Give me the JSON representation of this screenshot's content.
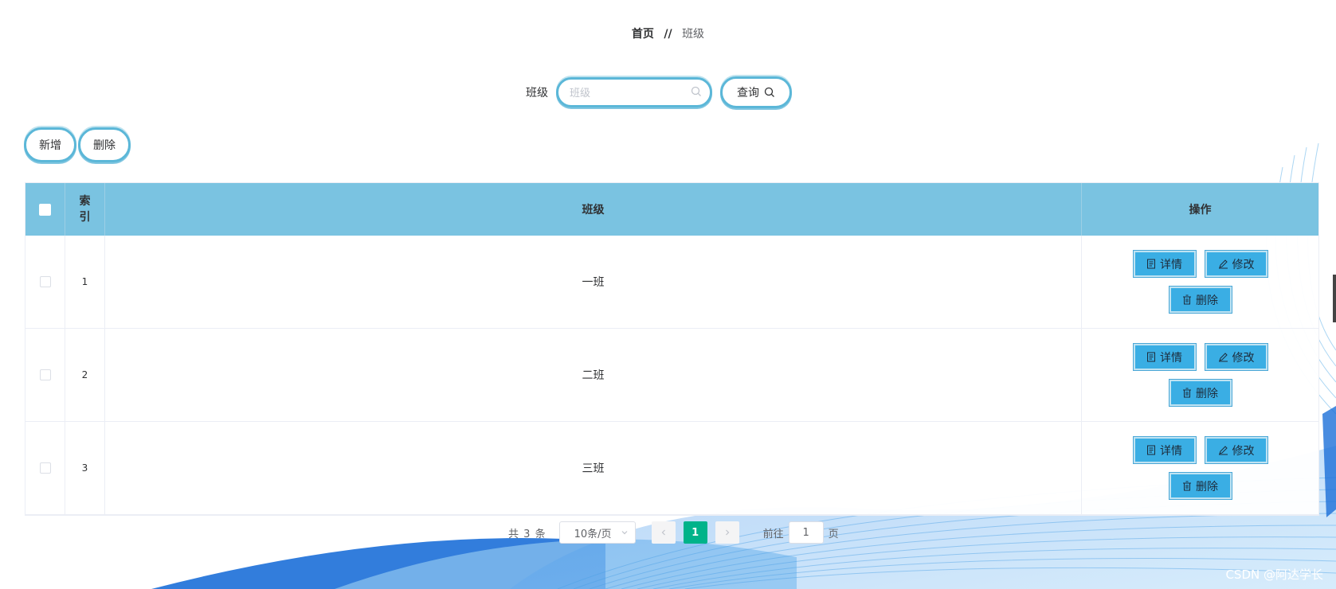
{
  "breadcrumb": {
    "home": "首页",
    "separator": "//",
    "current": "班级"
  },
  "search": {
    "label": "班级",
    "placeholder": "班级",
    "value": "",
    "query_label": "查询"
  },
  "actions": {
    "add_label": "新增",
    "delete_label": "删除"
  },
  "table": {
    "headers": {
      "index": "索引",
      "class": "班级",
      "ops": "操作"
    },
    "rows": [
      {
        "index": "1",
        "class": "一班"
      },
      {
        "index": "2",
        "class": "二班"
      },
      {
        "index": "3",
        "class": "三班"
      }
    ],
    "row_buttons": {
      "detail": "详情",
      "edit": "修改",
      "delete": "删除"
    }
  },
  "pagination": {
    "total_prefix": "共",
    "total": "3",
    "total_suffix": "条",
    "page_size": "10条/页",
    "current_page": "1",
    "goto_prefix": "前往",
    "goto_value": "1",
    "goto_suffix": "页"
  },
  "watermark": "CSDN @阿达学长",
  "colors": {
    "header_bg": "#7ac3e1",
    "button_bg": "#3aaee4",
    "active_page": "#00b38a",
    "pill_border": "#5bb7d8"
  }
}
